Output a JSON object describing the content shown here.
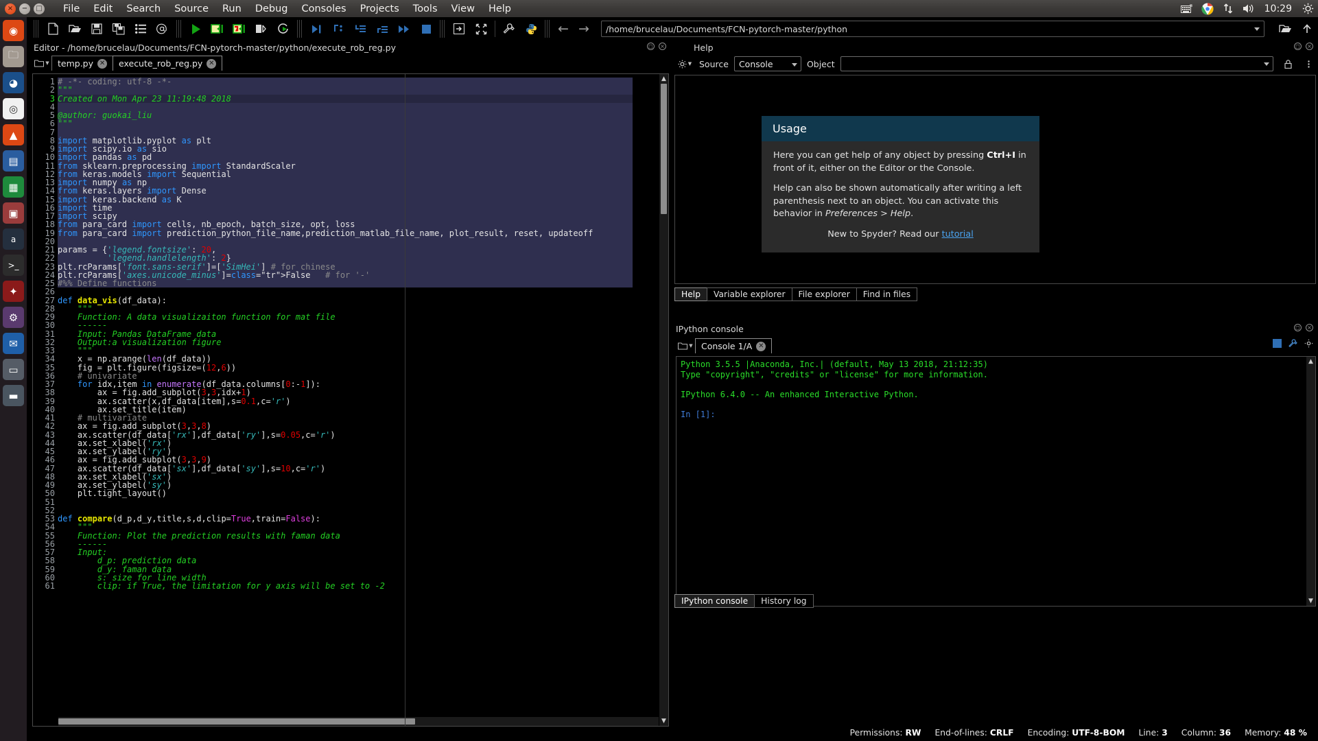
{
  "desktop": {
    "menu": [
      "File",
      "Edit",
      "Search",
      "Source",
      "Run",
      "Debug",
      "Consoles",
      "Projects",
      "Tools",
      "View",
      "Help"
    ],
    "tray_icons": [
      "keyboard-icon",
      "chrome-icon",
      "network-icon",
      "volume-icon",
      "power-gear-icon"
    ],
    "clock": "10:29",
    "launcher_items": [
      "ubuntu-dash-icon",
      "files-icon",
      "firefox-icon",
      "chrome-icon",
      "ubuntu-software-icon",
      "libreoffice-writer-icon",
      "libreoffice-calc-icon",
      "libreoffice-impress-icon",
      "amazon-icon",
      "terminal-icon",
      "spyder-icon",
      "settings-icon",
      "thunderbird-icon",
      "disk-icon",
      "printer-icon"
    ]
  },
  "toolbar": {
    "icons": [
      "new-file-icon",
      "open-file-icon",
      "save-icon",
      "save-all-icon",
      "list-icon",
      "at-icon",
      "run-icon",
      "run-cell-icon",
      "run-cell-advance-icon",
      "run-selection-icon",
      "rerun-icon",
      "debug-icon",
      "debug-step-icon",
      "debug-step-into-icon",
      "debug-step-return-icon",
      "debug-continue-icon",
      "stop-icon",
      "exit-icon",
      "maximize-icon",
      "preferences-icon",
      "python-icon"
    ],
    "back_arrow": "arrow-left-icon",
    "forward_arrow": "arrow-right-icon",
    "path": "/home/brucelau/Documents/FCN-pytorch-master/python"
  },
  "editor": {
    "title": "Editor - /home/brucelau/Documents/FCN-pytorch-master/python/execute_rob_reg.py",
    "browse_icon": "folder-browse-icon",
    "tabs": [
      {
        "label": "temp.py",
        "active": false
      },
      {
        "label": "execute_rob_reg.py",
        "active": true
      }
    ],
    "code_lines": [
      {
        "n": 1,
        "text": "# -*- coding: utf-8 -*-"
      },
      {
        "n": 2,
        "text": "\"\"\""
      },
      {
        "n": 3,
        "text": "Created on Mon Apr 23 11:19:48 2018"
      },
      {
        "n": 4,
        "text": ""
      },
      {
        "n": 5,
        "text": "@author: guokai_liu"
      },
      {
        "n": 6,
        "text": "\"\"\""
      },
      {
        "n": 7,
        "text": ""
      },
      {
        "n": 8,
        "text": "import matplotlib.pyplot as plt"
      },
      {
        "n": 9,
        "text": "import scipy.io as sio"
      },
      {
        "n": 10,
        "text": "import pandas as pd"
      },
      {
        "n": 11,
        "text": "from sklearn.preprocessing import StandardScaler"
      },
      {
        "n": 12,
        "text": "from keras.models import Sequential"
      },
      {
        "n": 13,
        "text": "import numpy as np"
      },
      {
        "n": 14,
        "text": "from keras.layers import Dense"
      },
      {
        "n": 15,
        "text": "import keras.backend as K"
      },
      {
        "n": 16,
        "text": "import time"
      },
      {
        "n": 17,
        "text": "import scipy"
      },
      {
        "n": 18,
        "text": "from para_card import cells, nb_epoch, batch_size, opt, loss"
      },
      {
        "n": 19,
        "text": "from para_card import prediction_python_file_name,prediction_matlab_file_name, plot_result, reset, updateoff"
      },
      {
        "n": 20,
        "text": ""
      },
      {
        "n": 21,
        "text": "params = {'legend.fontsize': 20,"
      },
      {
        "n": 22,
        "text": "          'legend.handlelength': 2}"
      },
      {
        "n": 23,
        "text": "plt.rcParams['font.sans-serif']=['SimHei'] # for chinese"
      },
      {
        "n": 24,
        "text": "plt.rcParams['axes.unicode_minus']=False   # for '-'"
      },
      {
        "n": 25,
        "text": "#%% Define functions"
      },
      {
        "n": 26,
        "text": ""
      },
      {
        "n": 27,
        "text": "def data_vis(df_data):"
      },
      {
        "n": 28,
        "text": "    \"\"\""
      },
      {
        "n": 29,
        "text": "    Function: A data visualizaiton function for mat file"
      },
      {
        "n": 30,
        "text": "    ------"
      },
      {
        "n": 31,
        "text": "    Input: Pandas DataFrame data"
      },
      {
        "n": 32,
        "text": "    Output:a visualization figure"
      },
      {
        "n": 33,
        "text": "    \"\"\""
      },
      {
        "n": 34,
        "text": "    x = np.arange(len(df_data))"
      },
      {
        "n": 35,
        "text": "    fig = plt.figure(figsize=(12,6))"
      },
      {
        "n": 36,
        "text": "    # univariate"
      },
      {
        "n": 37,
        "text": "    for idx,item in enumerate(df_data.columns[0:-1]):"
      },
      {
        "n": 38,
        "text": "        ax = fig.add_subplot(3,3,idx+1)"
      },
      {
        "n": 39,
        "text": "        ax.scatter(x,df_data[item],s=0.1,c='r')"
      },
      {
        "n": 40,
        "text": "        ax.set_title(item)"
      },
      {
        "n": 41,
        "text": "    # multivariate"
      },
      {
        "n": 42,
        "text": "    ax = fig.add_subplot(3,3,8)"
      },
      {
        "n": 43,
        "text": "    ax.scatter(df_data['rx'],df_data['ry'],s=0.05,c='r')"
      },
      {
        "n": 44,
        "text": "    ax.set_xlabel('rx')"
      },
      {
        "n": 45,
        "text": "    ax.set_ylabel('ry')"
      },
      {
        "n": 46,
        "text": "    ax = fig.add_subplot(3,3,9)"
      },
      {
        "n": 47,
        "text": "    ax.scatter(df_data['sx'],df_data['sy'],s=10,c='r')"
      },
      {
        "n": 48,
        "text": "    ax.set_xlabel('sx')"
      },
      {
        "n": 49,
        "text": "    ax.set_ylabel('sy')"
      },
      {
        "n": 50,
        "text": "    plt.tight_layout()"
      },
      {
        "n": 51,
        "text": ""
      },
      {
        "n": 52,
        "text": ""
      },
      {
        "n": 53,
        "text": "def compare(d_p,d_y,title,s,d,clip=True,train=False):"
      },
      {
        "n": 54,
        "text": "    \"\"\""
      },
      {
        "n": 55,
        "text": "    Function: Plot the prediction results with faman data"
      },
      {
        "n": 56,
        "text": "    ------"
      },
      {
        "n": 57,
        "text": "    Input:"
      },
      {
        "n": 58,
        "text": "        d_p: prediction data"
      },
      {
        "n": 59,
        "text": "        d_y: faman data"
      },
      {
        "n": 60,
        "text": "        s: size for line width"
      },
      {
        "n": 61,
        "text": "        clip: if True, the limitation for y axis will be set to -2"
      }
    ]
  },
  "help": {
    "title": "Help",
    "gear_icon": "gear-icon",
    "source_label": "Source",
    "source_value": "Console",
    "object_label": "Object",
    "object_value": "",
    "lock_icon": "lock-icon",
    "usage": {
      "heading": "Usage",
      "p1_a": "Here you can get help of any object by pressing ",
      "p1_b": "Ctrl+I",
      "p1_c": " in front of it, either on the Editor or the Console.",
      "p2_a": "Help can also be shown automatically after writing a left parenthesis next to an object. You can activate this behavior in ",
      "p2_b": "Preferences > Help",
      "p2_c": ".",
      "p3_a": "New to Spyder? Read our ",
      "p3_link": "tutorial"
    },
    "tabs": [
      {
        "label": "Help",
        "active": true
      },
      {
        "label": "Variable explorer",
        "active": false
      },
      {
        "label": "File explorer",
        "active": false
      },
      {
        "label": "Find in files",
        "active": false
      }
    ]
  },
  "console": {
    "title": "IPython console",
    "browse_icon": "folder-browse-icon",
    "tab": {
      "label": "Console 1/A",
      "close_icon": "close-icon"
    },
    "tools": [
      "stop-icon",
      "options-icon",
      "settings-icon"
    ],
    "lines": [
      {
        "text": "Python 3.5.5 |Anaconda, Inc.| (default, May 13 2018, 21:12:35)",
        "color": "green"
      },
      {
        "text": "Type \"copyright\", \"credits\" or \"license\" for more information.",
        "color": "green"
      },
      {
        "text": "",
        "color": "green"
      },
      {
        "text": "IPython 6.4.0 -- An enhanced Interactive Python.",
        "color": "green"
      },
      {
        "text": "",
        "color": "green"
      },
      {
        "text": "In [1]:",
        "color": "blue"
      }
    ],
    "tabs": [
      {
        "label": "IPython console",
        "active": true
      },
      {
        "label": "History log",
        "active": false
      }
    ]
  },
  "statusbar": {
    "permissions_label": "Permissions:",
    "permissions_value": "RW",
    "eol_label": "End-of-lines:",
    "eol_value": "CRLF",
    "encoding_label": "Encoding:",
    "encoding_value": "UTF-8-BOM",
    "line_label": "Line:",
    "line_value": "3",
    "column_label": "Column:",
    "column_value": "36",
    "memory_label": "Memory:",
    "memory_value": "48 %"
  },
  "colors": {
    "accent_blue": "#2f97ff",
    "string_teal": "#36b9b9",
    "comment_gray": "#8a8a8a",
    "number_red": "#e00000",
    "usage_header": "#10384d",
    "cell_highlight": "#2f2f4f"
  }
}
